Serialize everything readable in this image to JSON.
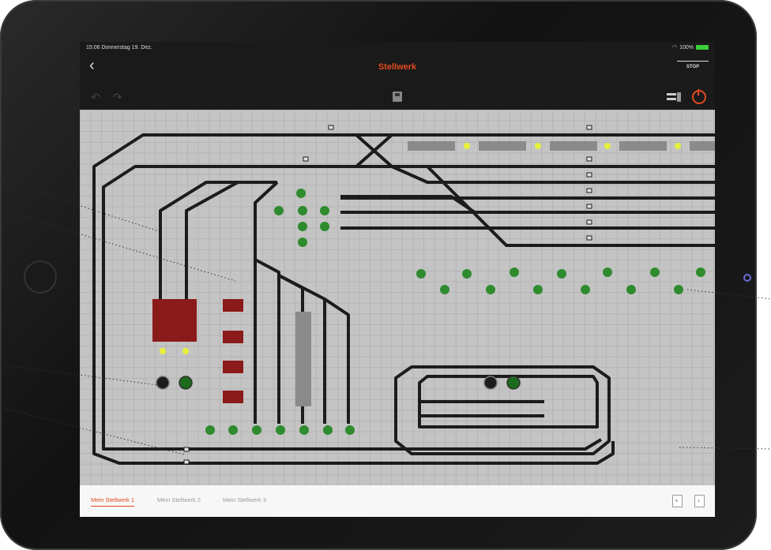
{
  "statusbar": {
    "time_date": "15:06  Donnerstag 19. Dez.",
    "battery": "100%"
  },
  "navbar": {
    "back_icon": "chevron-left-icon",
    "title": "Stellwerk",
    "stop_label": "STOP"
  },
  "toolbar": {
    "icons": [
      "undo-icon",
      "redo-icon",
      "save-icon",
      "track-layout-icon",
      "power-icon"
    ]
  },
  "tabs": [
    {
      "label": "Mein Stellwerk 1",
      "active": true
    },
    {
      "label": "Mein Stellwerk 2",
      "active": false
    },
    {
      "label": "Mein Stellwerk 3",
      "active": false
    }
  ],
  "colors": {
    "accent": "#e24a1f",
    "track": "#1c1c1c",
    "tree": "#2e8b2e",
    "building": "#8b1a1a",
    "signal": "#e8f03a"
  }
}
